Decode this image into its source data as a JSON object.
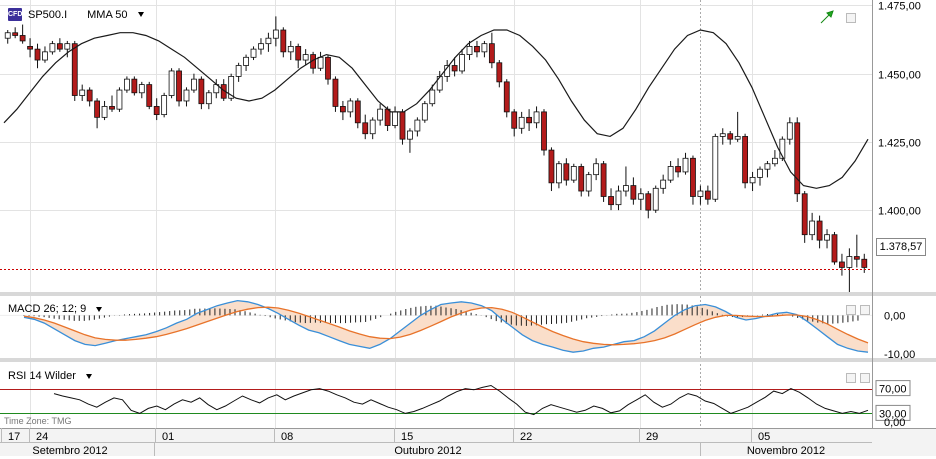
{
  "chart_data": {
    "type": "candlestick",
    "price_panel": {
      "symbol": "SP500.I",
      "symbol_icon": "CFD",
      "indicator_label": "MMA 50",
      "y_ticks": [
        "1.475,00",
        "1.450,00",
        "1.425,00",
        "1.400,00"
      ],
      "ylim": [
        1370,
        1477
      ],
      "last_price": 1378.57,
      "last_price_label": "1.378,57",
      "candles": [
        {
          "o": 1463,
          "h": 1466,
          "l": 1461,
          "c": 1465
        },
        {
          "o": 1465,
          "h": 1467,
          "l": 1463,
          "c": 1464
        },
        {
          "o": 1464,
          "h": 1468,
          "l": 1461,
          "c": 1462
        },
        {
          "o": 1460,
          "h": 1463,
          "l": 1456,
          "c": 1459
        },
        {
          "o": 1459,
          "h": 1461,
          "l": 1452,
          "c": 1455
        },
        {
          "o": 1455,
          "h": 1460,
          "l": 1454,
          "c": 1458
        },
        {
          "o": 1458,
          "h": 1462,
          "l": 1457,
          "c": 1461
        },
        {
          "o": 1461,
          "h": 1463,
          "l": 1458,
          "c": 1459
        },
        {
          "o": 1459,
          "h": 1462,
          "l": 1456,
          "c": 1461
        },
        {
          "o": 1461,
          "h": 1462,
          "l": 1440,
          "c": 1442
        },
        {
          "o": 1442,
          "h": 1446,
          "l": 1440,
          "c": 1444
        },
        {
          "o": 1444,
          "h": 1445,
          "l": 1438,
          "c": 1440
        },
        {
          "o": 1440,
          "h": 1441,
          "l": 1430,
          "c": 1434
        },
        {
          "o": 1434,
          "h": 1440,
          "l": 1433,
          "c": 1438
        },
        {
          "o": 1438,
          "h": 1442,
          "l": 1436,
          "c": 1437
        },
        {
          "o": 1437,
          "h": 1445,
          "l": 1436,
          "c": 1444
        },
        {
          "o": 1444,
          "h": 1449,
          "l": 1443,
          "c": 1448
        },
        {
          "o": 1448,
          "h": 1449,
          "l": 1442,
          "c": 1443
        },
        {
          "o": 1443,
          "h": 1447,
          "l": 1441,
          "c": 1446
        },
        {
          "o": 1446,
          "h": 1447,
          "l": 1437,
          "c": 1438
        },
        {
          "o": 1438,
          "h": 1441,
          "l": 1433,
          "c": 1435
        },
        {
          "o": 1435,
          "h": 1443,
          "l": 1434,
          "c": 1442
        },
        {
          "o": 1442,
          "h": 1452,
          "l": 1441,
          "c": 1451
        },
        {
          "o": 1451,
          "h": 1452,
          "l": 1438,
          "c": 1440
        },
        {
          "o": 1440,
          "h": 1445,
          "l": 1438,
          "c": 1444
        },
        {
          "o": 1444,
          "h": 1450,
          "l": 1443,
          "c": 1448
        },
        {
          "o": 1448,
          "h": 1449,
          "l": 1437,
          "c": 1439
        },
        {
          "o": 1439,
          "h": 1444,
          "l": 1437,
          "c": 1443
        },
        {
          "o": 1443,
          "h": 1448,
          "l": 1441,
          "c": 1446
        },
        {
          "o": 1446,
          "h": 1448,
          "l": 1440,
          "c": 1441
        },
        {
          "o": 1441,
          "h": 1450,
          "l": 1440,
          "c": 1449
        },
        {
          "o": 1449,
          "h": 1454,
          "l": 1447,
          "c": 1453
        },
        {
          "o": 1453,
          "h": 1457,
          "l": 1451,
          "c": 1456
        },
        {
          "o": 1456,
          "h": 1460,
          "l": 1455,
          "c": 1459
        },
        {
          "o": 1459,
          "h": 1463,
          "l": 1457,
          "c": 1461
        },
        {
          "o": 1461,
          "h": 1465,
          "l": 1458,
          "c": 1463
        },
        {
          "o": 1463,
          "h": 1471,
          "l": 1460,
          "c": 1466
        },
        {
          "o": 1466,
          "h": 1467,
          "l": 1456,
          "c": 1458
        },
        {
          "o": 1458,
          "h": 1462,
          "l": 1455,
          "c": 1460
        },
        {
          "o": 1460,
          "h": 1461,
          "l": 1452,
          "c": 1455
        },
        {
          "o": 1455,
          "h": 1459,
          "l": 1453,
          "c": 1457
        },
        {
          "o": 1457,
          "h": 1458,
          "l": 1450,
          "c": 1452
        },
        {
          "o": 1452,
          "h": 1458,
          "l": 1451,
          "c": 1456
        },
        {
          "o": 1456,
          "h": 1457,
          "l": 1446,
          "c": 1448
        },
        {
          "o": 1448,
          "h": 1449,
          "l": 1436,
          "c": 1438
        },
        {
          "o": 1438,
          "h": 1440,
          "l": 1433,
          "c": 1436
        },
        {
          "o": 1436,
          "h": 1441,
          "l": 1434,
          "c": 1440
        },
        {
          "o": 1440,
          "h": 1441,
          "l": 1430,
          "c": 1432
        },
        {
          "o": 1432,
          "h": 1435,
          "l": 1426,
          "c": 1428
        },
        {
          "o": 1428,
          "h": 1434,
          "l": 1426,
          "c": 1433
        },
        {
          "o": 1433,
          "h": 1439,
          "l": 1431,
          "c": 1437
        },
        {
          "o": 1437,
          "h": 1438,
          "l": 1429,
          "c": 1431
        },
        {
          "o": 1431,
          "h": 1438,
          "l": 1430,
          "c": 1436
        },
        {
          "o": 1436,
          "h": 1437,
          "l": 1424,
          "c": 1426
        },
        {
          "o": 1426,
          "h": 1430,
          "l": 1421,
          "c": 1429
        },
        {
          "o": 1429,
          "h": 1434,
          "l": 1427,
          "c": 1433
        },
        {
          "o": 1433,
          "h": 1440,
          "l": 1432,
          "c": 1439
        },
        {
          "o": 1439,
          "h": 1446,
          "l": 1438,
          "c": 1444
        },
        {
          "o": 1444,
          "h": 1451,
          "l": 1443,
          "c": 1449
        },
        {
          "o": 1449,
          "h": 1455,
          "l": 1447,
          "c": 1453
        },
        {
          "o": 1453,
          "h": 1456,
          "l": 1449,
          "c": 1451
        },
        {
          "o": 1451,
          "h": 1459,
          "l": 1450,
          "c": 1457
        },
        {
          "o": 1457,
          "h": 1462,
          "l": 1455,
          "c": 1460
        },
        {
          "o": 1460,
          "h": 1462,
          "l": 1456,
          "c": 1458
        },
        {
          "o": 1458,
          "h": 1462,
          "l": 1456,
          "c": 1461
        },
        {
          "o": 1461,
          "h": 1465,
          "l": 1452,
          "c": 1454
        },
        {
          "o": 1454,
          "h": 1455,
          "l": 1445,
          "c": 1447
        },
        {
          "o": 1447,
          "h": 1448,
          "l": 1434,
          "c": 1436
        },
        {
          "o": 1436,
          "h": 1437,
          "l": 1427,
          "c": 1430
        },
        {
          "o": 1430,
          "h": 1436,
          "l": 1428,
          "c": 1434
        },
        {
          "o": 1434,
          "h": 1437,
          "l": 1429,
          "c": 1432
        },
        {
          "o": 1432,
          "h": 1438,
          "l": 1430,
          "c": 1436
        },
        {
          "o": 1436,
          "h": 1437,
          "l": 1420,
          "c": 1422
        },
        {
          "o": 1422,
          "h": 1423,
          "l": 1407,
          "c": 1410
        },
        {
          "o": 1410,
          "h": 1418,
          "l": 1408,
          "c": 1417
        },
        {
          "o": 1417,
          "h": 1419,
          "l": 1409,
          "c": 1411
        },
        {
          "o": 1411,
          "h": 1417,
          "l": 1410,
          "c": 1416
        },
        {
          "o": 1416,
          "h": 1417,
          "l": 1405,
          "c": 1407
        },
        {
          "o": 1407,
          "h": 1414,
          "l": 1405,
          "c": 1413
        },
        {
          "o": 1413,
          "h": 1419,
          "l": 1411,
          "c": 1417
        },
        {
          "o": 1417,
          "h": 1418,
          "l": 1403,
          "c": 1405
        },
        {
          "o": 1405,
          "h": 1408,
          "l": 1400,
          "c": 1402
        },
        {
          "o": 1402,
          "h": 1409,
          "l": 1400,
          "c": 1407
        },
        {
          "o": 1407,
          "h": 1416,
          "l": 1405,
          "c": 1409
        },
        {
          "o": 1409,
          "h": 1412,
          "l": 1402,
          "c": 1404
        },
        {
          "o": 1404,
          "h": 1408,
          "l": 1400,
          "c": 1406
        },
        {
          "o": 1406,
          "h": 1407,
          "l": 1397,
          "c": 1400
        },
        {
          "o": 1400,
          "h": 1409,
          "l": 1399,
          "c": 1408
        },
        {
          "o": 1408,
          "h": 1413,
          "l": 1406,
          "c": 1411
        },
        {
          "o": 1411,
          "h": 1418,
          "l": 1410,
          "c": 1416
        },
        {
          "o": 1416,
          "h": 1419,
          "l": 1412,
          "c": 1414
        },
        {
          "o": 1414,
          "h": 1421,
          "l": 1413,
          "c": 1419
        },
        {
          "o": 1419,
          "h": 1420,
          "l": 1402,
          "c": 1405
        },
        {
          "o": 1405,
          "h": 1409,
          "l": 1402,
          "c": 1407
        },
        {
          "o": 1407,
          "h": 1409,
          "l": 1402,
          "c": 1404
        },
        {
          "o": 1404,
          "h": 1428,
          "l": 1403,
          "c": 1427
        },
        {
          "o": 1427,
          "h": 1430,
          "l": 1424,
          "c": 1428
        },
        {
          "o": 1428,
          "h": 1429,
          "l": 1424,
          "c": 1426
        },
        {
          "o": 1426,
          "h": 1436,
          "l": 1425,
          "c": 1427
        },
        {
          "o": 1427,
          "h": 1428,
          "l": 1408,
          "c": 1410
        },
        {
          "o": 1410,
          "h": 1414,
          "l": 1407,
          "c": 1412
        },
        {
          "o": 1412,
          "h": 1416,
          "l": 1409,
          "c": 1415
        },
        {
          "o": 1415,
          "h": 1418,
          "l": 1412,
          "c": 1417
        },
        {
          "o": 1417,
          "h": 1422,
          "l": 1416,
          "c": 1419
        },
        {
          "o": 1419,
          "h": 1427,
          "l": 1418,
          "c": 1426
        },
        {
          "o": 1426,
          "h": 1434,
          "l": 1424,
          "c": 1432
        },
        {
          "o": 1432,
          "h": 1434,
          "l": 1403,
          "c": 1406
        },
        {
          "o": 1406,
          "h": 1407,
          "l": 1388,
          "c": 1391
        },
        {
          "o": 1391,
          "h": 1399,
          "l": 1389,
          "c": 1396
        },
        {
          "o": 1396,
          "h": 1398,
          "l": 1386,
          "c": 1389
        },
        {
          "o": 1389,
          "h": 1393,
          "l": 1386,
          "c": 1391
        },
        {
          "o": 1391,
          "h": 1392,
          "l": 1380,
          "c": 1381
        },
        {
          "o": 1381,
          "h": 1384,
          "l": 1376,
          "c": 1379
        },
        {
          "o": 1379,
          "h": 1386,
          "l": 1370,
          "c": 1383
        },
        {
          "o": 1383,
          "h": 1391,
          "l": 1379,
          "c": 1382
        },
        {
          "o": 1382,
          "h": 1384,
          "l": 1377,
          "c": 1379
        }
      ],
      "ma50": [
        1432,
        1437,
        1443,
        1449,
        1454,
        1458,
        1461,
        1463,
        1464,
        1465,
        1465,
        1464,
        1462,
        1459,
        1456,
        1452,
        1448,
        1444,
        1441,
        1440,
        1441,
        1444,
        1448,
        1452,
        1455,
        1457,
        1456,
        1452,
        1446,
        1440,
        1436,
        1436,
        1439,
        1444,
        1450,
        1456,
        1461,
        1464,
        1466,
        1466,
        1464,
        1460,
        1455,
        1448,
        1440,
        1433,
        1428,
        1427,
        1430,
        1437,
        1445,
        1452,
        1459,
        1464,
        1466,
        1465,
        1461,
        1454,
        1445,
        1434,
        1423,
        1414,
        1409,
        1408,
        1409,
        1412,
        1418,
        1426
      ]
    },
    "macd_panel": {
      "label": "MACD 26; 12; 9",
      "y_ticks": [
        "0,00",
        "-10,00"
      ],
      "ylim": [
        -11,
        5
      ],
      "macd": [
        -0.5,
        -1,
        -2,
        -3.5,
        -5,
        -6.5,
        -7.5,
        -7.8,
        -7.2,
        -6.5,
        -6,
        -5.5,
        -5,
        -4.2,
        -3.2,
        -2,
        -1,
        0.5,
        1.5,
        2.5,
        3.2,
        3.8,
        3.5,
        2.8,
        1.8,
        0.5,
        -1,
        -2.5,
        -3.8,
        -4.5,
        -5.5,
        -6.5,
        -7.5,
        -8,
        -8.5,
        -7.5,
        -6,
        -4,
        -2,
        0,
        1.5,
        2.8,
        3.2,
        3.5,
        3.2,
        2.5,
        1.2,
        -1,
        -3,
        -5,
        -6.5,
        -7.5,
        -8.2,
        -9,
        -9.5,
        -9.2,
        -8.5,
        -8.2,
        -7.5,
        -6.8,
        -6.5,
        -5.5,
        -4,
        -2,
        0,
        1.5,
        2.5,
        2.8,
        2.2,
        1,
        -0.5,
        -1.2,
        -0.8,
        -0.2,
        0.5,
        0.8,
        0.2,
        -1.5,
        -3.5,
        -5.5,
        -7.5,
        -8.5,
        -9.2,
        -9.5
      ],
      "signal": [
        -0.2,
        -0.6,
        -1.2,
        -2,
        -3,
        -4,
        -5,
        -5.8,
        -6.2,
        -6.4,
        -6.4,
        -6.2,
        -5.9,
        -5.5,
        -4.9,
        -4.2,
        -3.4,
        -2.5,
        -1.6,
        -0.7,
        0.2,
        1,
        1.6,
        2,
        2.1,
        1.9,
        1.3,
        0.6,
        -0.3,
        -1.2,
        -2.1,
        -3,
        -4,
        -4.8,
        -5.5,
        -5.9,
        -6,
        -5.6,
        -4.9,
        -3.9,
        -2.8,
        -1.6,
        -0.4,
        0.6,
        1.4,
        1.9,
        2,
        1.6,
        0.8,
        -0.4,
        -1.7,
        -3,
        -4.2,
        -5.2,
        -6.1,
        -6.8,
        -7.2,
        -7.5,
        -7.6,
        -7.5,
        -7.3,
        -7,
        -6.5,
        -5.8,
        -4.8,
        -3.6,
        -2.4,
        -1.3,
        -0.5,
        0,
        0,
        -0.2,
        -0.3,
        -0.3,
        -0.1,
        0.1,
        0.1,
        -0.3,
        -1.1,
        -2.2,
        -3.6,
        -4.9,
        -6.1,
        -7.1
      ]
    },
    "rsi_panel": {
      "label": "RSI 14 Wilder",
      "y_ticks": [
        "70,00",
        "30,00",
        "0,00"
      ],
      "ylim": [
        0,
        100
      ],
      "upper_level": 70,
      "lower_level": 30,
      "values": [
        62,
        58,
        55,
        52,
        45,
        40,
        48,
        55,
        52,
        35,
        30,
        38,
        42,
        36,
        45,
        52,
        48,
        55,
        44,
        36,
        42,
        50,
        58,
        52,
        47,
        55,
        60,
        52,
        58,
        63,
        68,
        70,
        66,
        60,
        55,
        48,
        45,
        52,
        46,
        40,
        36,
        30,
        33,
        38,
        44,
        50,
        58,
        65,
        70,
        68,
        72,
        75,
        66,
        55,
        45,
        32,
        28,
        38,
        44,
        40,
        36,
        32,
        35,
        42,
        38,
        31,
        34,
        44,
        52,
        60,
        48,
        40,
        45,
        55,
        62,
        58,
        50,
        46,
        38,
        30,
        35,
        40,
        48,
        56,
        66,
        62,
        70,
        64,
        55,
        45,
        38,
        34,
        30,
        33,
        30,
        35
      ]
    },
    "x_axis": {
      "day_labels": [
        "17",
        "24",
        "01",
        "08",
        "15",
        "22",
        "29",
        "05"
      ],
      "month_labels": [
        "Setembro 2012",
        "Outubro 2012",
        "Novembro 2012"
      ]
    },
    "time_zone": "Time Zone: TMG"
  },
  "colors": {
    "bull": "#ffffff",
    "bear": "#b31b1b",
    "ma_line": "#1a1a1a",
    "macd_line": "#3a8fd8",
    "signal_line": "#e8732a",
    "macd_fill_pos": "#bfdcf7",
    "macd_fill_neg": "#f9d6bd",
    "rsi_upper": "#b31b1b",
    "rsi_lower": "#1f8a1f",
    "last_price_line": "#cc0000",
    "up_arrow": "#22aa22"
  },
  "icons": {
    "up_arrow": "trend-up-arrow-icon",
    "window": "window-restore-icon"
  }
}
